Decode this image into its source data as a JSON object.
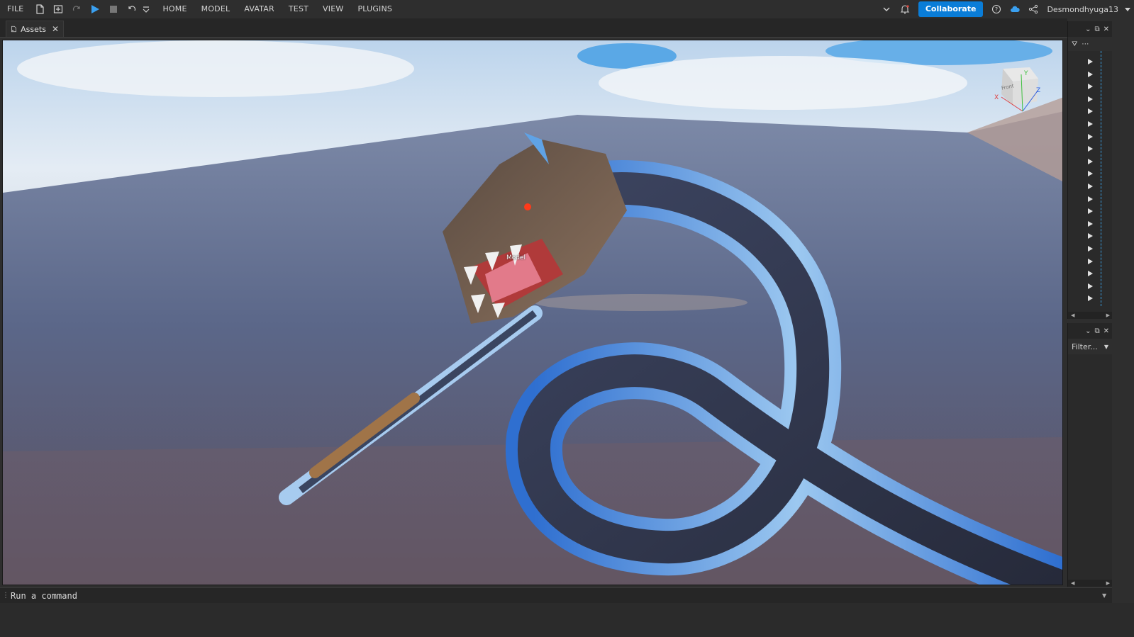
{
  "menubar": {
    "file": "FILE",
    "tabs": [
      "HOME",
      "MODEL",
      "AVATAR",
      "TEST",
      "VIEW",
      "PLUGINS"
    ],
    "collaborate": "Collaborate",
    "username": "Desmondhyuga13"
  },
  "tabs": {
    "assets": "Assets"
  },
  "viewport": {
    "selection_label": "Model",
    "view_cube_face": "Front",
    "axis_x": "X",
    "axis_y": "Y",
    "axis_z": "Z"
  },
  "properties": {
    "filter_placeholder": "Filter..."
  },
  "command": {
    "placeholder": "Run a command"
  },
  "colors": {
    "accent": "#0a7dd8",
    "play": "#3aa0f0",
    "tree_guide": "#3aa0e6"
  },
  "explorer": {
    "collapsed_rows": 20
  }
}
